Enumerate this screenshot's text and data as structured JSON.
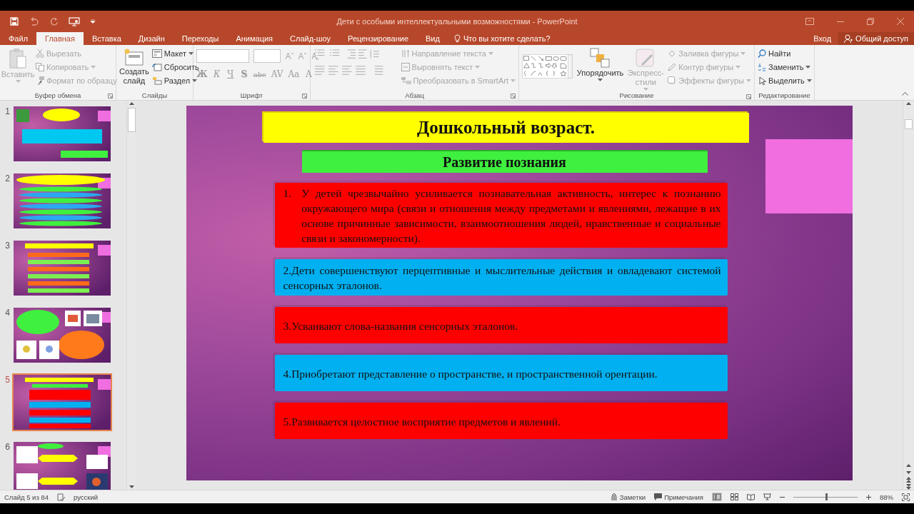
{
  "window": {
    "title": "Дети с особыми интеллектуальными возможностями - PowerPoint"
  },
  "tabs": [
    {
      "label": "Файл",
      "selected": false
    },
    {
      "label": "Главная",
      "selected": true
    },
    {
      "label": "Вставка",
      "selected": false
    },
    {
      "label": "Дизайн",
      "selected": false
    },
    {
      "label": "Переходы",
      "selected": false
    },
    {
      "label": "Анимация",
      "selected": false
    },
    {
      "label": "Слайд-шоу",
      "selected": false
    },
    {
      "label": "Рецензирование",
      "selected": false
    },
    {
      "label": "Вид",
      "selected": false
    }
  ],
  "tell_me": {
    "placeholder": "Что вы хотите сделать?"
  },
  "account": {
    "sign_in": "Вход",
    "share": "Общий доступ"
  },
  "ribbon": {
    "clipboard": {
      "label": "Буфер обмена",
      "paste": {
        "label": "Вставить",
        "disabled": true
      },
      "items": [
        {
          "label": "Вырезать",
          "disabled": true
        },
        {
          "label": "Копировать",
          "disabled": true
        },
        {
          "label": "Формат по образцу",
          "disabled": true
        }
      ]
    },
    "slides": {
      "label": "Слайды",
      "new_slide": {
        "label": "Создать слайд"
      },
      "items": [
        {
          "label": "Макет",
          "disabled": false
        },
        {
          "label": "Сбросить",
          "disabled": false
        },
        {
          "label": "Раздел",
          "disabled": false
        }
      ]
    },
    "font": {
      "label": "Шрифт",
      "buttons": [
        {
          "label": "Ж",
          "kind": "bold"
        },
        {
          "label": "К",
          "kind": "italic"
        },
        {
          "label": "Ч",
          "kind": "underline"
        },
        {
          "label": "S",
          "kind": "shadow"
        },
        {
          "label": "abc",
          "kind": "strike"
        },
        {
          "label": "AV",
          "kind": "spacing"
        },
        {
          "label": "Aa",
          "kind": "case"
        },
        {
          "label": "A",
          "kind": "color"
        }
      ]
    },
    "paragraph": {
      "label": "Абзац",
      "items": [
        {
          "label": "Направление текста",
          "disabled": true
        },
        {
          "label": "Выровнять текст",
          "disabled": true
        },
        {
          "label": "Преобразовать в SmartArt",
          "disabled": true
        }
      ]
    },
    "drawing": {
      "label": "Рисование",
      "arrange": {
        "label": "Упорядочить",
        "disabled": false
      },
      "quick_styles": {
        "label": "Экспресс-стили",
        "disabled": true
      },
      "items": [
        {
          "label": "Заливка фигуры",
          "disabled": true
        },
        {
          "label": "Контур фигуры",
          "disabled": true
        },
        {
          "label": "Эффекты фигуры",
          "disabled": true
        }
      ]
    },
    "editing": {
      "label": "Редактирование",
      "items": [
        {
          "label": "Найти",
          "disabled": false
        },
        {
          "label": "Заменить",
          "disabled": false
        },
        {
          "label": "Выделить",
          "disabled": false
        }
      ]
    }
  },
  "thumbnails": [
    {
      "number": "1",
      "selected": false
    },
    {
      "number": "2",
      "selected": false
    },
    {
      "number": "3",
      "selected": false
    },
    {
      "number": "4",
      "selected": false
    },
    {
      "number": "5",
      "selected": true
    },
    {
      "number": "6",
      "selected": false
    }
  ],
  "slide": {
    "title": "Дошкольный возраст.",
    "subtitle": "Развитие познания",
    "items": [
      {
        "marker": "1.",
        "text": "У детей чрезвычайно усиливается познавательная активность, интерес к познанию окружающего мира (связи и отношения между предметами и явлениями, лежащие в их основе причинные зависимости, взаимоотношения людей, нравственные и социальные связи и закономерности).",
        "color": "#ff0000"
      },
      {
        "text": "2.Дети совершенствуют перцептивные и мыслительные действия и овладевают системой сенсорных эталонов.",
        "color": "#00b0f0"
      },
      {
        "text": "3.Усваивают слова-названия сенсорных эталонов.",
        "color": "#ff0000"
      },
      {
        "text": "4.Приобретают представление о пространстве, и пространственной орентации.",
        "color": "#00b0f0"
      },
      {
        "text": "5.Развивается целостное восприятие предметов и явлений.",
        "color": "#ff0000"
      }
    ]
  },
  "status_bar": {
    "slide": "Слайд 5 из 84",
    "language": "русский",
    "notes": "Заметки",
    "comments": "Примечания",
    "zoom": "88%",
    "zoom_slider": {
      "level": 0.5
    }
  }
}
